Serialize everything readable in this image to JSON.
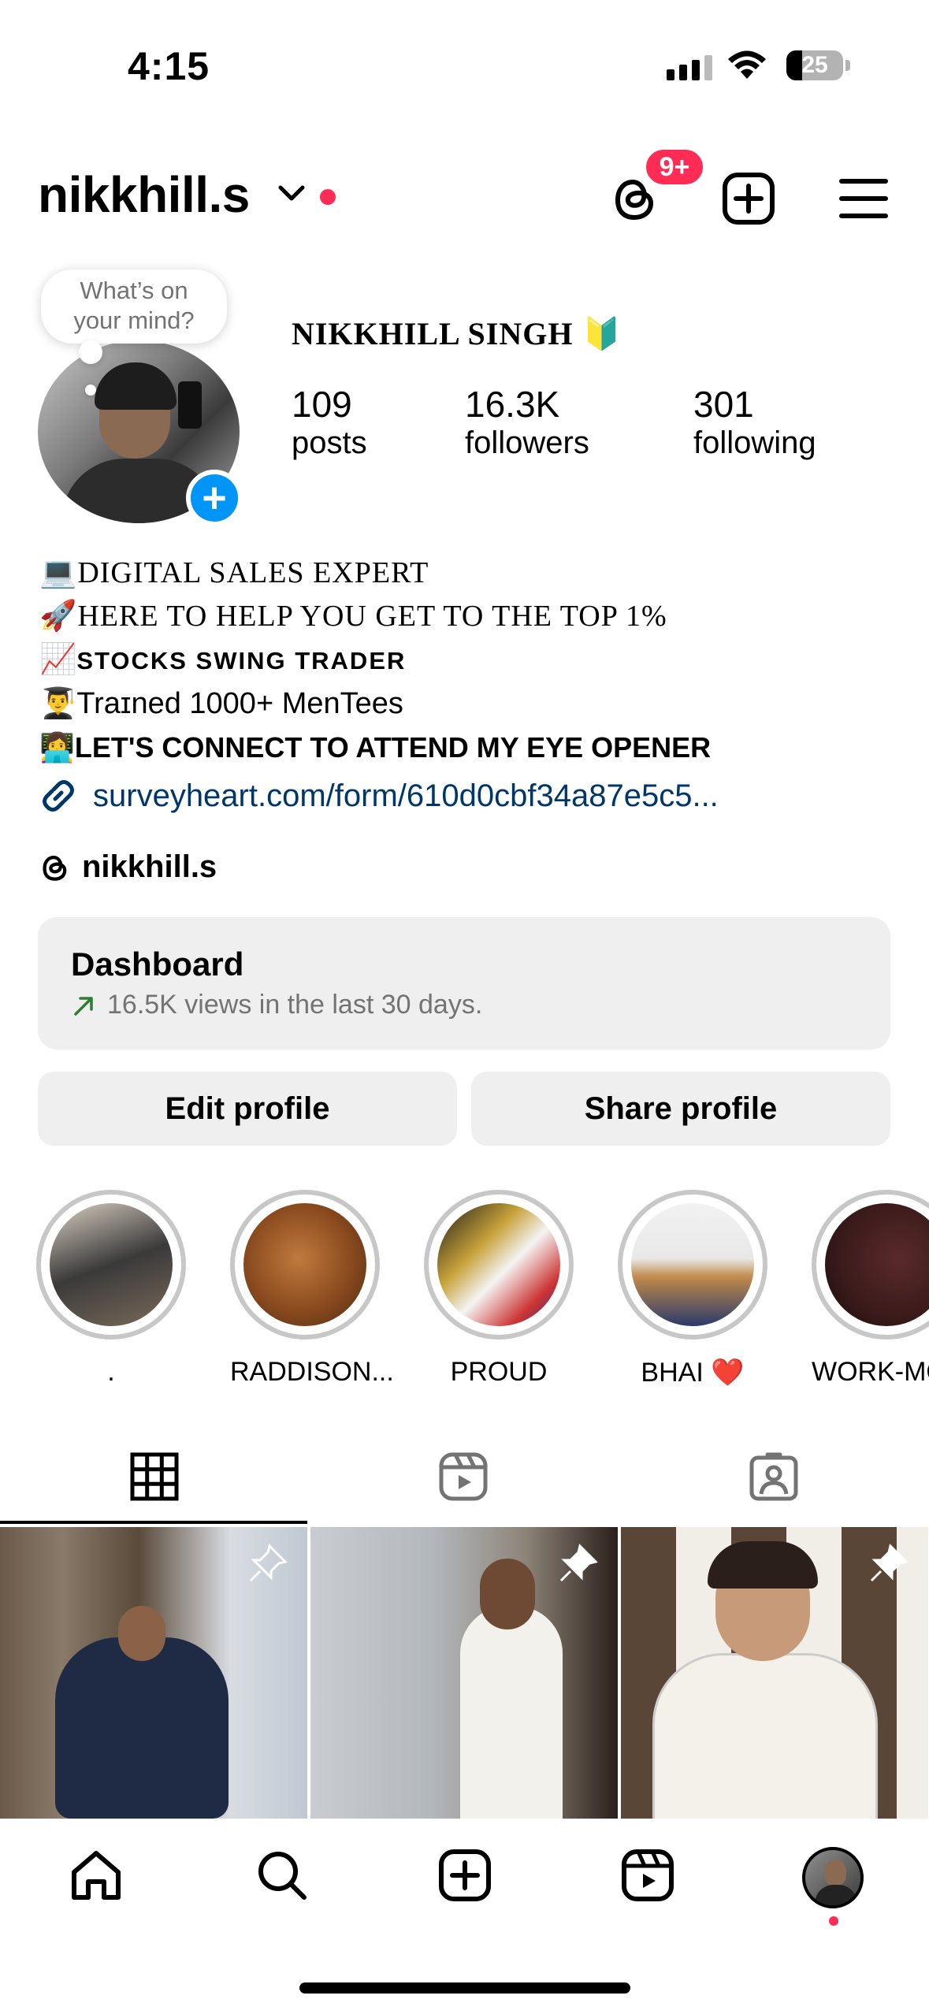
{
  "status_bar": {
    "time": "4:15",
    "battery": "25"
  },
  "header": {
    "username": "nikkhill.s",
    "notification_badge": "9+"
  },
  "profile": {
    "note_bubble": [
      "What’s on",
      "your mind?"
    ],
    "full_name": "NIKKHILL SINGH 🔰",
    "stats": [
      {
        "value": "109",
        "label": "posts"
      },
      {
        "value": "16.3K",
        "label": "followers"
      },
      {
        "value": "301",
        "label": "following"
      }
    ],
    "bio": [
      {
        "emoji": "💻",
        "text": "DIGITAL SALES EXPERT"
      },
      {
        "emoji": "🚀",
        "text": "HERE TO HELP YOU GET TO THE TOP 1%"
      },
      {
        "emoji": "📈",
        "text": "STOCKS SWING TRADER"
      },
      {
        "emoji": "👨‍🎓",
        "text": "Traɪned 1000+ MenTees"
      },
      {
        "emoji": "👩‍💻",
        "text": "LET'S CONNECT TO ATTEND MY EYE OPENER"
      }
    ],
    "link": "surveyheart.com/form/610d0cbf34a87e5c5...",
    "threads_handle": "nikkhill.s"
  },
  "dashboard": {
    "title": "Dashboard",
    "subtitle": "16.5K views in the last 30 days."
  },
  "buttons": {
    "edit": "Edit profile",
    "share": "Share profile"
  },
  "highlights": [
    {
      "label": "."
    },
    {
      "label": "RADDISON..."
    },
    {
      "label": "PROUD"
    },
    {
      "label": "BHAI ❤️"
    },
    {
      "label": "WORK-MO"
    }
  ],
  "colors": {
    "accent": "#0095f6",
    "badge": "#ff2d55",
    "link": "#00376b",
    "muted": "#737373"
  }
}
